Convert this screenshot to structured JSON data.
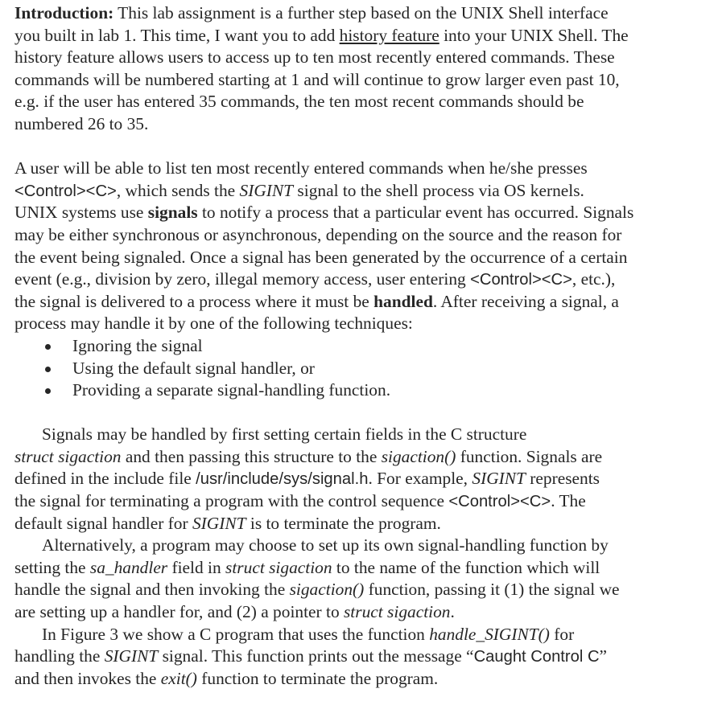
{
  "document": {
    "intro": {
      "label": "Introduction:",
      "l1": " This lab assignment is a further step based on the UNIX Shell interface",
      "l2a": "you built in lab 1. This time, I want you to add ",
      "l2_link": "history feature",
      "l2b": " into your UNIX Shell. The",
      "l3": "history feature allows users to access up to ten most recently entered commands. These",
      "l4": "commands will be numbered starting at 1 and will continue to grow larger even past 10,",
      "l5": "e.g. if the user has entered 35 commands, the ten most recent commands should be",
      "l6": "numbered 26 to 35."
    },
    "signals": {
      "l1": "A user will be able to list ten most recently entered commands when he/she presses",
      "l2a": "<Control><C>",
      "l2b": ", which sends the ",
      "l2c": "SIGINT",
      "l2d": " signal to the shell process via OS kernels.",
      "l3a": "UNIX systems use ",
      "l3b": "signals",
      "l3c": " to notify a process that a particular event has occurred. Signals",
      "l4": "may be either synchronous or asynchronous, depending on the source and the reason for",
      "l5": "the event being signaled. Once a signal has been generated by the occurrence of a certain",
      "l6a": "event (e.g., division by zero, illegal memory access, user entering ",
      "l6b": "<Control><C>",
      "l6c": ", etc.),",
      "l7a": "the signal is delivered to a process where it must be ",
      "l7b": "handled",
      "l7c": ". After receiving a signal, a",
      "l8": "process may handle it by one of the following techniques:"
    },
    "techniques": [
      "Ignoring the signal",
      "Using the default signal handler, or",
      "Providing a separate signal-handling function."
    ],
    "sigaction": {
      "l1": "Signals may be handled by first setting certain fields in the C structure",
      "l2a": "struct sigaction",
      "l2b": " and then passing this structure to the ",
      "l2c": "sigaction()",
      "l2d": " function. Signals are",
      "l3a": "defined in the include file ",
      "l3b": "/usr/include/sys/signal.h",
      "l3c": ". For example, ",
      "l3d": "SIGINT",
      "l3e": " represents",
      "l4a": "the signal for terminating a program with the control sequence ",
      "l4b": "<Control><C>",
      "l4c": ". The",
      "l5a": "default signal handler for ",
      "l5b": "SIGINT",
      "l5c": " is to terminate the program."
    },
    "alternative": {
      "l1": "Alternatively, a program may choose to set up its own signal-handling function by",
      "l2a": "setting the ",
      "l2b": "sa_handler",
      "l2c": " field in ",
      "l2d": "struct sigaction",
      "l2e": " to the name of the function which will",
      "l3a": "handle the signal and then invoking the ",
      "l3b": "sigaction()",
      "l3c": " function, passing it (1) the signal we",
      "l4a": "are setting up a handler for, and (2) a pointer to ",
      "l4b": "struct sigaction",
      "l4c": "."
    },
    "figure": {
      "l1a": "In Figure 3 we show a C program that uses the function ",
      "l1b": "handle_SIGINT()",
      "l1c": " for",
      "l2a": "handling the ",
      "l2b": "SIGINT",
      "l2c": " signal. This function prints out the message “",
      "l2d": "Caught Control C",
      "l2e": "”",
      "l3a": "and then invokes the ",
      "l3b": "exit()",
      "l3c": " function to terminate the program."
    }
  }
}
